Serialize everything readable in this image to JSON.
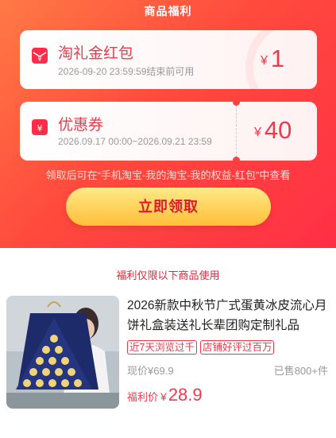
{
  "header": {
    "title": "商品福利"
  },
  "coupons": [
    {
      "name": "淘礼金红包",
      "desc": "2026-09-20 23:59:59结束前可用",
      "currency": "¥",
      "amount": "1",
      "icon": "red-envelope-icon"
    },
    {
      "name": "优惠券",
      "desc": "2026.09.17 00:00~2026.09.21 23:59",
      "currency": "¥",
      "amount": "40",
      "icon": "coupon-icon"
    }
  ],
  "hint": "领取后可在“手机淘宝-我的淘宝-我的权益-红包”中查看",
  "claim_button": "立即领取",
  "section_title": "福利仅限以下商品使用",
  "product": {
    "title": "2026新款中秋节广式蛋黄冰皮流心月饼礼盒装送礼长辈团购定制礼品",
    "tags": [
      "近7天浏览过千",
      "店铺好评过百万"
    ],
    "price_label": "现价",
    "price_currency": "¥",
    "price": "69.9",
    "sold": "已售800+件",
    "benefit_label": "福利价",
    "benefit_currency": "¥",
    "benefit_price": "28.9"
  },
  "colors": {
    "accent": "#f2384b",
    "header_gradient_start": "#ff7a45",
    "header_gradient_end": "#ff2f45",
    "button_gold": "#ffd25a"
  }
}
